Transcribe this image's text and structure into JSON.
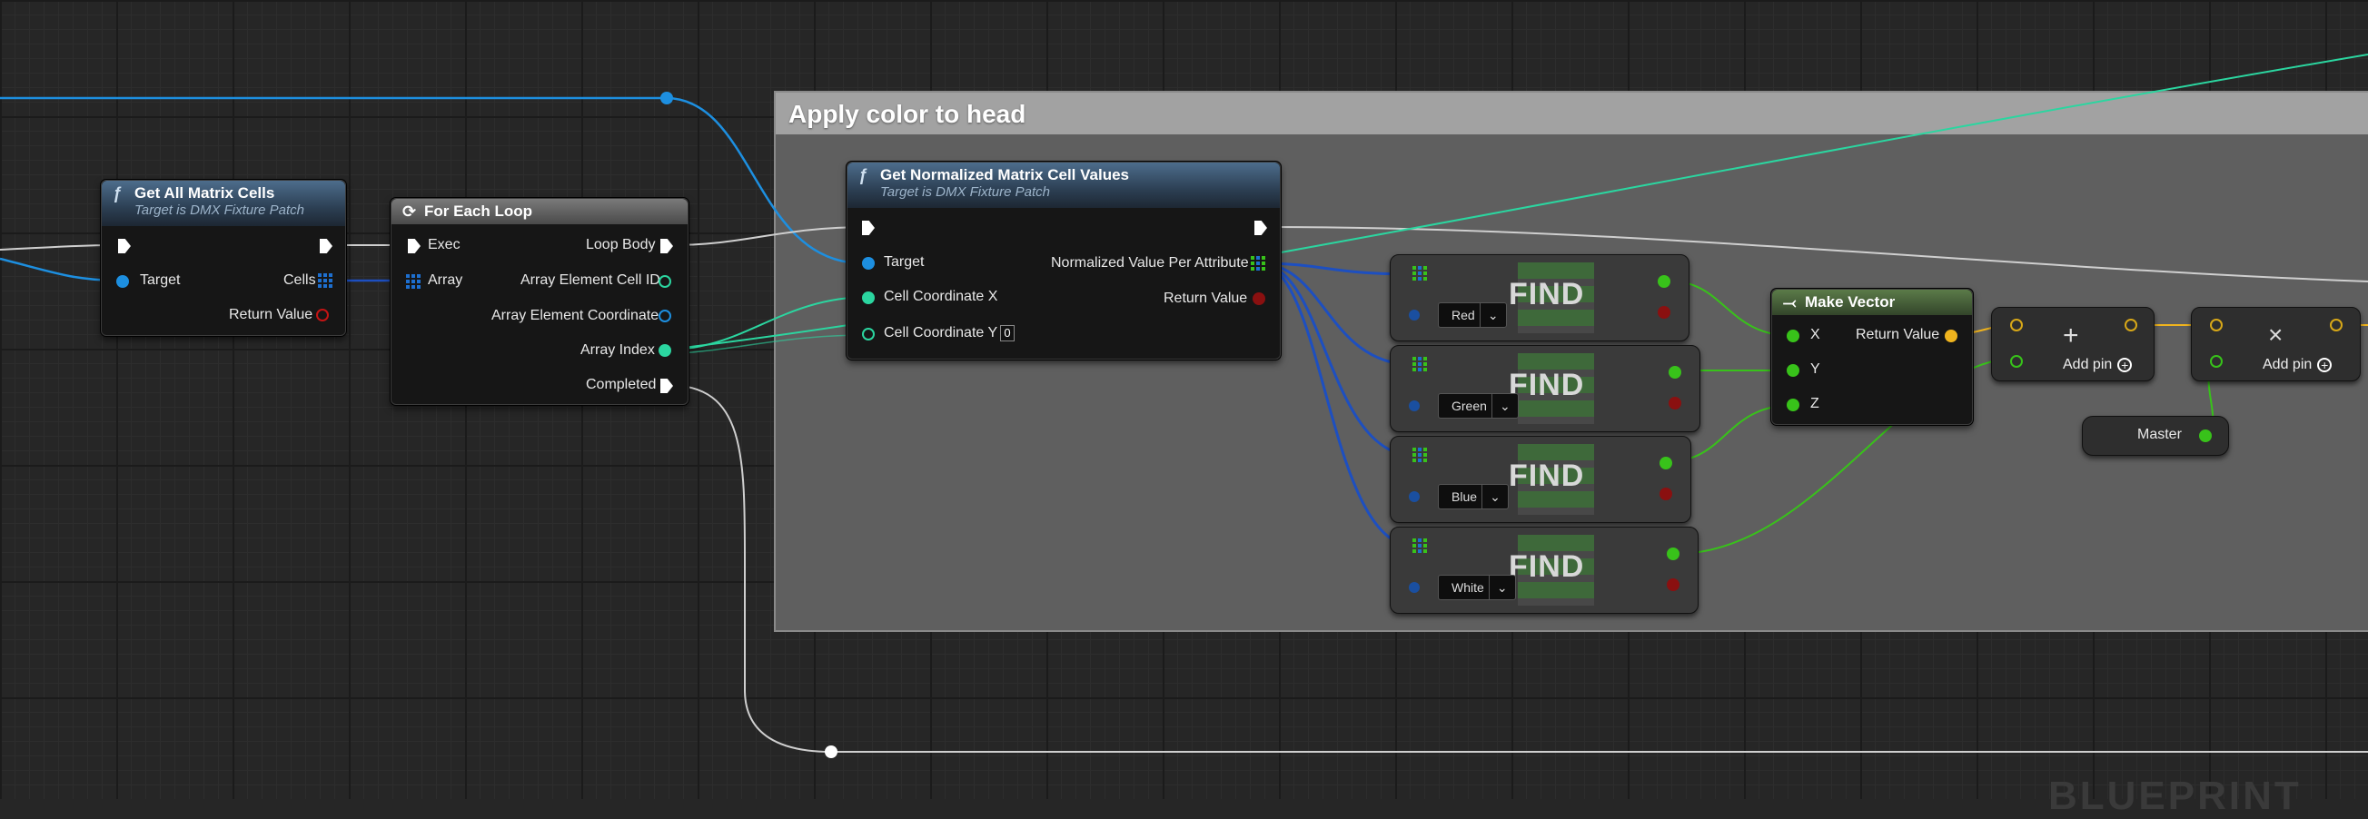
{
  "comment": {
    "title": "Apply color to head"
  },
  "get_all_cells": {
    "title": "Get All Matrix Cells",
    "subtitle": "Target is DMX Fixture Patch",
    "target": "Target",
    "cells": "Cells",
    "return_value": "Return Value"
  },
  "for_each": {
    "title": "For Each Loop",
    "exec": "Exec",
    "array": "Array",
    "loop_body": "Loop Body",
    "cell_id": "Array Element Cell ID",
    "coordinate": "Array Element Coordinate",
    "index": "Array Index",
    "completed": "Completed"
  },
  "get_normalized": {
    "title": "Get Normalized Matrix Cell Values",
    "subtitle": "Target is DMX Fixture Patch",
    "target": "Target",
    "coord_x": "Cell Coordinate X",
    "coord_y": "Cell Coordinate Y",
    "coord_y_value": "0",
    "norm_value": "Normalized Value Per Attribute",
    "return_value": "Return Value"
  },
  "find_nodes": [
    {
      "label": "FIND",
      "key": "Red"
    },
    {
      "label": "FIND",
      "key": "Green"
    },
    {
      "label": "FIND",
      "key": "Blue"
    },
    {
      "label": "FIND",
      "key": "White"
    }
  ],
  "make_vector": {
    "title": "Make Vector",
    "x": "X",
    "y": "Y",
    "z": "Z",
    "return_value": "Return Value"
  },
  "add_node": {
    "symbol": "+",
    "label": "Add pin"
  },
  "multiply_node": {
    "symbol": "×",
    "label": "Add pin"
  },
  "master": {
    "label": "Master"
  },
  "watermark": "BLUEPRINT",
  "colors": {
    "exec": "#ffffff",
    "object": "#1d8fe0",
    "int": "#2bd6a0",
    "float": "#38c21a",
    "vector": "#f0b41e",
    "comment": "#5f5f5f"
  }
}
